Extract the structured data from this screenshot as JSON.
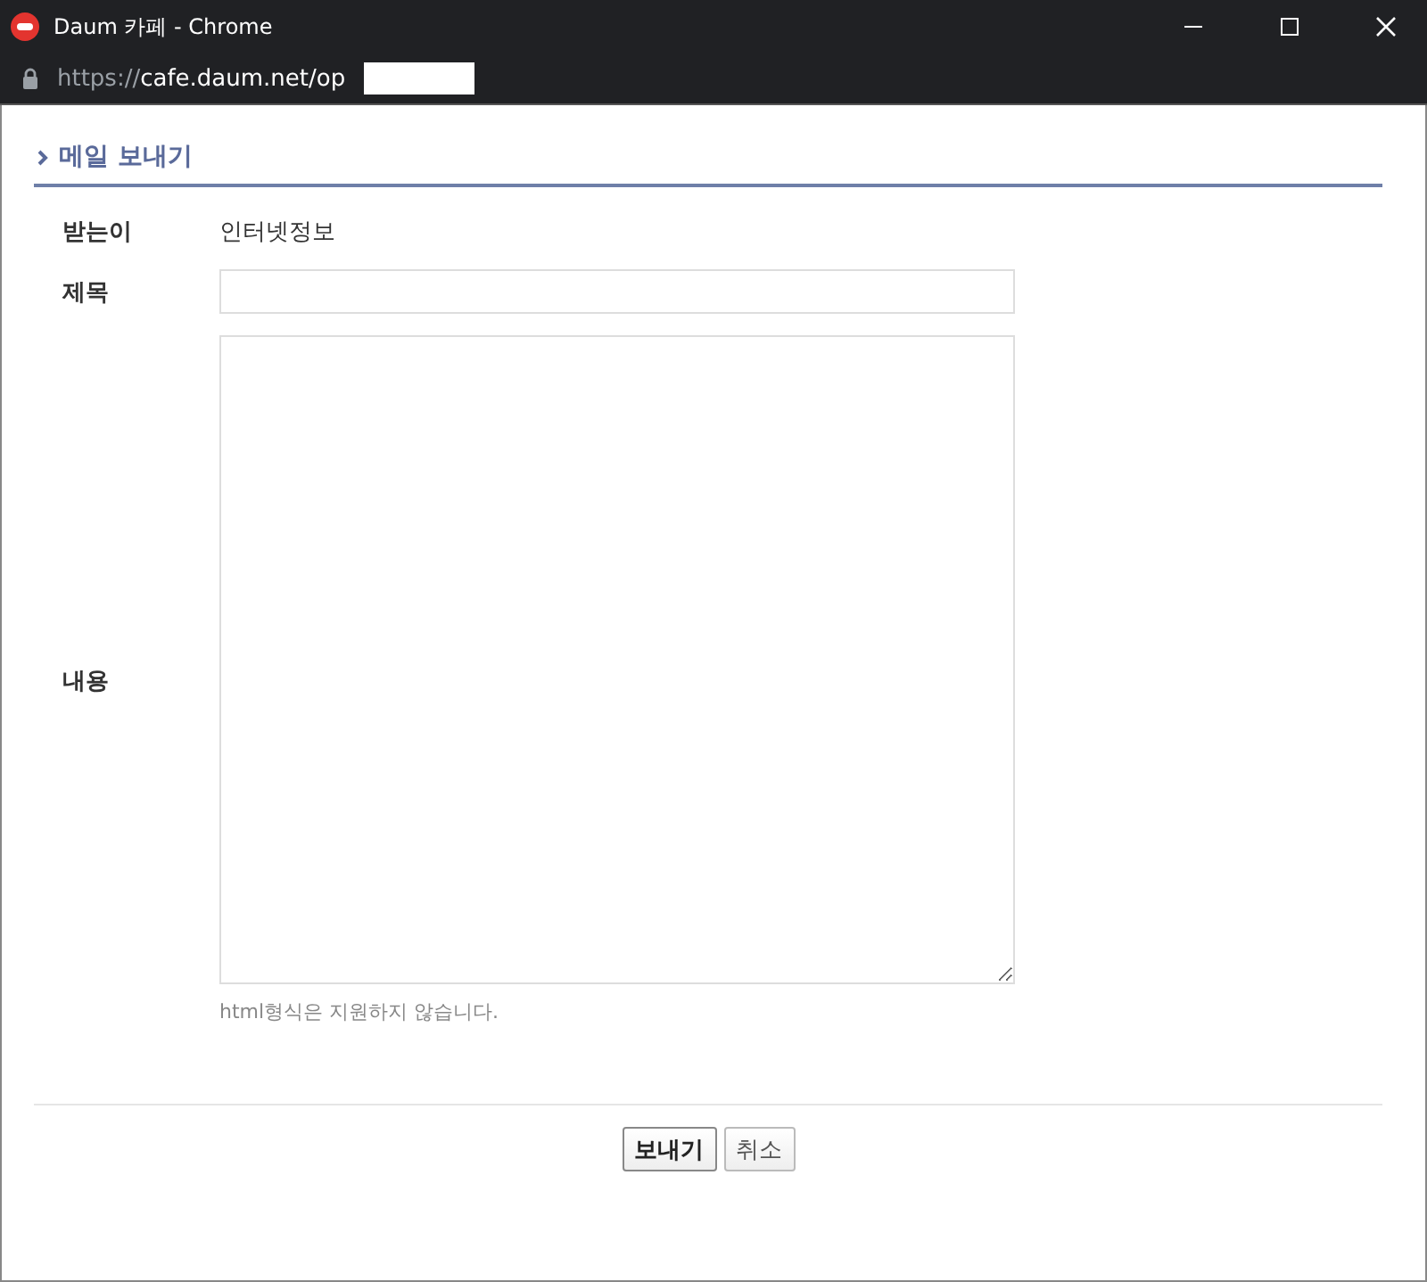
{
  "window": {
    "title": "Daum 카페 - Chrome",
    "url_scheme": "https://",
    "url_host": "cafe.daum.net/op"
  },
  "heading": "메일 보내기",
  "fields": [
    {
      "kind": "text",
      "label": "받는이",
      "value": "인터넷정보"
    },
    {
      "kind": "input",
      "label": "제목"
    },
    {
      "kind": "textarea",
      "label": "내용",
      "hint": "html형식은 지원하지 않습니다."
    }
  ],
  "buttons": [
    {
      "label": "보내기",
      "primary": true
    },
    {
      "label": "취소",
      "primary": false
    }
  ]
}
